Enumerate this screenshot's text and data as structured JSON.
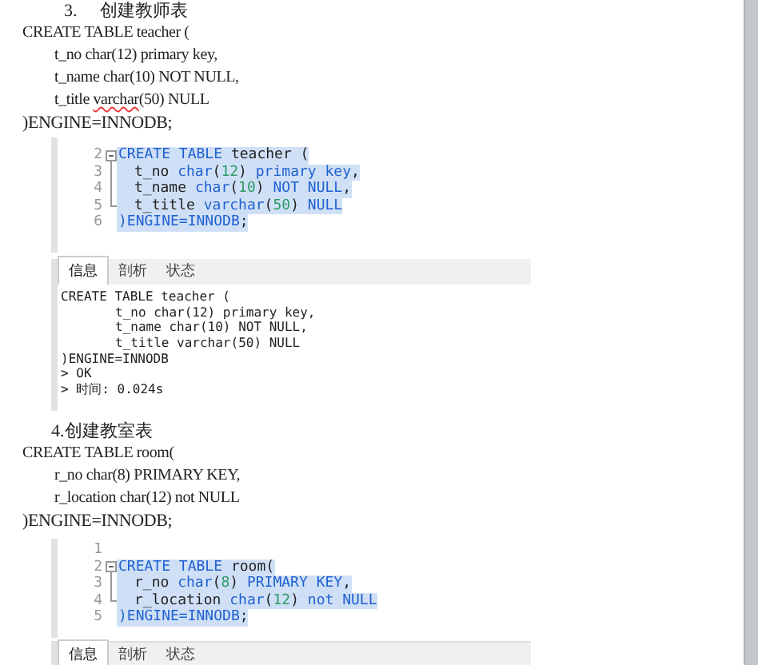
{
  "sections": [
    {
      "number": "3.",
      "title": "创建教师表",
      "code": [
        {
          "indent": false,
          "segments": [
            {
              "text": "CREATE TABLE teacher (",
              "misspelled": false
            }
          ]
        },
        {
          "indent": true,
          "segments": [
            {
              "text": "t_no char(12) primary key,",
              "misspelled": false
            }
          ]
        },
        {
          "indent": true,
          "segments": [
            {
              "text": "t_name char(10) NOT NULL,",
              "misspelled": false
            }
          ]
        },
        {
          "indent": true,
          "segments": [
            {
              "text": "t_title ",
              "misspelled": false
            },
            {
              "text": "varchar",
              "misspelled": true
            },
            {
              "text": "(50) NULL",
              "misspelled": false
            }
          ]
        },
        {
          "indent": false,
          "segments": [
            {
              "text": ")ENGINE=INNODB;",
              "misspelled": false
            }
          ]
        }
      ],
      "editor": {
        "lines": [
          {
            "number": "2",
            "kind": "start",
            "indent": false,
            "selected": true,
            "tokens": [
              {
                "kind": "kw",
                "text": "CREATE TABLE"
              },
              {
                "kind": "plain",
                "text": " teacher ("
              }
            ]
          },
          {
            "number": "3",
            "kind": "mid",
            "indent": true,
            "selected": true,
            "tokens": [
              {
                "kind": "plain",
                "text": "t_no "
              },
              {
                "kind": "kw",
                "text": "char"
              },
              {
                "kind": "plain",
                "text": "("
              },
              {
                "kind": "num",
                "text": "12"
              },
              {
                "kind": "plain",
                "text": ") "
              },
              {
                "kind": "kw",
                "text": "primary key"
              },
              {
                "kind": "plain",
                "text": ","
              }
            ]
          },
          {
            "number": "4",
            "kind": "mid",
            "indent": true,
            "selected": true,
            "tokens": [
              {
                "kind": "plain",
                "text": "t_name "
              },
              {
                "kind": "kw",
                "text": "char"
              },
              {
                "kind": "plain",
                "text": "("
              },
              {
                "kind": "num",
                "text": "10"
              },
              {
                "kind": "plain",
                "text": ") "
              },
              {
                "kind": "kw",
                "text": "NOT NULL"
              },
              {
                "kind": "plain",
                "text": ","
              }
            ]
          },
          {
            "number": "5",
            "kind": "end",
            "indent": true,
            "selected": true,
            "tokens": [
              {
                "kind": "plain",
                "text": "t_title "
              },
              {
                "kind": "kw",
                "text": "varchar"
              },
              {
                "kind": "plain",
                "text": "("
              },
              {
                "kind": "num",
                "text": "50"
              },
              {
                "kind": "plain",
                "text": ") "
              },
              {
                "kind": "kw",
                "text": "NULL"
              }
            ]
          },
          {
            "number": "6",
            "indent": false,
            "selected": true,
            "tokens": [
              {
                "kind": "kw",
                "text": ")ENGINE=INNODB"
              },
              {
                "kind": "plain",
                "text": ";"
              }
            ]
          }
        ]
      },
      "result": {
        "tabs": [
          {
            "label": "信息",
            "selected": true
          },
          {
            "label": "剖析",
            "selected": false
          },
          {
            "label": "状态",
            "selected": false
          }
        ],
        "output": [
          {
            "indent": false,
            "text": "CREATE TABLE teacher ("
          },
          {
            "indent": true,
            "text": "t_no char(12) primary key,"
          },
          {
            "indent": true,
            "text": "t_name char(10) NOT NULL,"
          },
          {
            "indent": true,
            "text": "t_title varchar(50) NULL"
          },
          {
            "indent": false,
            "text": ")ENGINE=INNODB"
          },
          {
            "indent": false,
            "text": "> OK"
          },
          {
            "indent": false,
            "text": "> 时间: 0.024s"
          }
        ]
      }
    },
    {
      "number": "4.",
      "title": "创建教室表",
      "code": [
        {
          "indent": false,
          "segments": [
            {
              "text": "CREATE TABLE room(",
              "misspelled": false
            }
          ]
        },
        {
          "indent": true,
          "segments": [
            {
              "text": "r_no char(8) PRIMARY KEY,",
              "misspelled": false
            }
          ]
        },
        {
          "indent": true,
          "segments": [
            {
              "text": "r_location char(12) not NULL",
              "misspelled": false
            }
          ]
        },
        {
          "indent": false,
          "segments": [
            {
              "text": ")ENGINE=INNODB;",
              "misspelled": false
            }
          ]
        }
      ],
      "editor": {
        "lines": [
          {
            "number": "1"
          },
          {
            "number": "2",
            "kind": "start",
            "indent": false,
            "selected": true,
            "tokens": [
              {
                "kind": "kw",
                "text": "CREATE TABLE"
              },
              {
                "kind": "plain",
                "text": " room("
              }
            ]
          },
          {
            "number": "3",
            "kind": "mid",
            "indent": true,
            "selected": true,
            "tokens": [
              {
                "kind": "plain",
                "text": "r_no "
              },
              {
                "kind": "kw",
                "text": "char"
              },
              {
                "kind": "plain",
                "text": "("
              },
              {
                "kind": "num",
                "text": "8"
              },
              {
                "kind": "plain",
                "text": ") "
              },
              {
                "kind": "kw",
                "text": "PRIMARY KEY"
              },
              {
                "kind": "plain",
                "text": ","
              }
            ]
          },
          {
            "number": "4",
            "kind": "end",
            "indent": true,
            "selected": true,
            "tokens": [
              {
                "kind": "plain",
                "text": "r_location "
              },
              {
                "kind": "kw",
                "text": "char"
              },
              {
                "kind": "plain",
                "text": "("
              },
              {
                "kind": "num",
                "text": "12"
              },
              {
                "kind": "plain",
                "text": ") "
              },
              {
                "kind": "kw",
                "text": "not NULL"
              }
            ]
          },
          {
            "number": "5",
            "indent": false,
            "selected": true,
            "tokens": [
              {
                "kind": "kw",
                "text": ")ENGINE=INNODB"
              },
              {
                "kind": "plain",
                "text": ";"
              }
            ]
          }
        ]
      },
      "result": {
        "tabs": [
          {
            "label": "信息",
            "selected": true
          },
          {
            "label": "剖析",
            "selected": false
          },
          {
            "label": "状态",
            "selected": false
          }
        ]
      }
    }
  ]
}
